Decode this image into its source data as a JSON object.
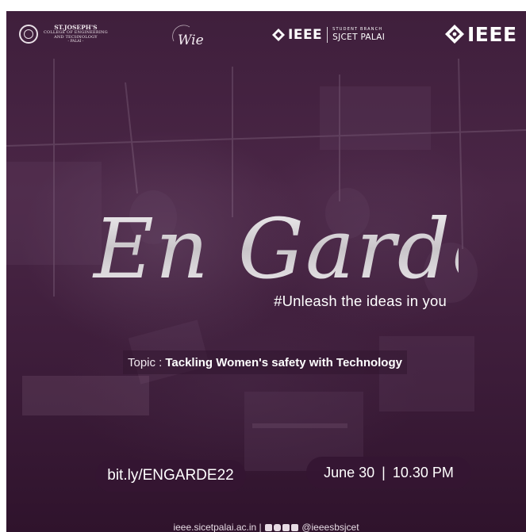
{
  "header": {
    "college_name_line1": "ST.JOSEPH'S",
    "college_name_line2": "COLLEGE OF ENGINEERING",
    "college_name_line3": "AND TECHNOLOGY",
    "college_place": "- PALAI -",
    "wie_logo_text": "Wie",
    "student_branch_ieee": "IEEE",
    "student_branch_label": "STUDENT BRANCH",
    "student_branch_name": "SJCET PALAI",
    "ieee_logo_text": "IEEE"
  },
  "event": {
    "title": "En Garde",
    "tagline": "#Unleash the ideas in you",
    "topic_label": "Topic :",
    "topic": "Tackling Women's safety with Technology",
    "link": "bit.ly/ENGARDE22",
    "date": "June 30",
    "separator": "|",
    "time": "10.30 PM"
  },
  "footer": {
    "website": "ieee.sicetpalai.ac.in",
    "separator": "|",
    "social_handle": "@ieeesbsjcet",
    "social_icons": [
      "facebook-icon",
      "instagram-icon",
      "youtube-icon",
      "linkedin-icon"
    ]
  },
  "colors": {
    "background": "#3f1f3c",
    "pill": "#341632",
    "text": "#ffffff",
    "title_silver": "#d9d6d9"
  }
}
